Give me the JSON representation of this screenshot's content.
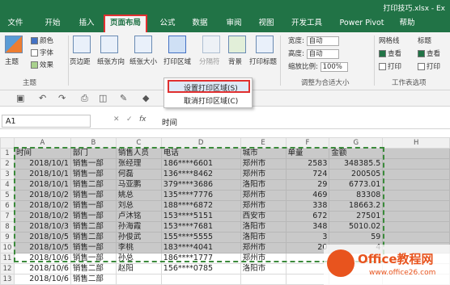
{
  "window": {
    "title": "打印技巧.xlsx - Ex"
  },
  "tabs": [
    "文件",
    "开始",
    "插入",
    "页面布局",
    "公式",
    "数据",
    "审阅",
    "视图",
    "开发工具",
    "Power Pivot",
    "帮助"
  ],
  "ribbon": {
    "theme": {
      "main": "主题",
      "colors": "颜色",
      "fonts": "字体",
      "effects": "效果"
    },
    "page_setup": {
      "margins": "页边距",
      "orientation": "纸张方向",
      "size": "纸张大小",
      "print_area": "打印区域",
      "breaks": "分隔符",
      "background": "背景",
      "print_titles": "打印标题"
    },
    "scale": {
      "width_label": "宽度:",
      "width_value": "自动",
      "height_label": "高度:",
      "height_value": "自动",
      "scale_label": "缩放比例:",
      "scale_value": "100%",
      "group": "调整为合适大小"
    },
    "sheet_options": {
      "gridlines": "网格线",
      "headings": "标题",
      "view1": "查看",
      "view2": "查看",
      "print1": "打印",
      "print2": "打印",
      "group": "工作表选项"
    },
    "group_theme": "主题"
  },
  "menu": {
    "set": "设置打印区域(S)",
    "clear": "取消打印区域(C)"
  },
  "namebox": "A1",
  "formula": "时间",
  "columns": [
    "A",
    "B",
    "C",
    "D",
    "E",
    "F",
    "G",
    "H"
  ],
  "rows": [
    [
      "时间",
      "部门",
      "销售人员",
      "电话",
      "城市",
      "单量",
      "金额"
    ],
    [
      "2018/10/1",
      "销售一部",
      "张经理",
      "186****6601",
      "郑州市",
      "2583",
      "348385.5"
    ],
    [
      "2018/10/1",
      "销售一部",
      "何磊",
      "136****8462",
      "郑州市",
      "724",
      "200505"
    ],
    [
      "2018/10/1",
      "销售二部",
      "马亚鹏",
      "379****3686",
      "洛阳市",
      "29",
      "6773.01"
    ],
    [
      "2018/10/2",
      "销售一部",
      "姚总",
      "135****7776",
      "郑州市",
      "469",
      "83308"
    ],
    [
      "2018/10/2",
      "销售一部",
      "刘总",
      "188****6872",
      "郑州市",
      "338",
      "18663.2"
    ],
    [
      "2018/10/2",
      "销售一部",
      "卢沐铭",
      "153****5151",
      "西安市",
      "672",
      "27501"
    ],
    [
      "2018/10/3",
      "销售二部",
      "孙海霞",
      "153****7681",
      "洛阳市",
      "348",
      "5010.02"
    ],
    [
      "2018/10/5",
      "销售二部",
      "孙俊武",
      "155****5555",
      "洛阳市",
      "3",
      "59"
    ],
    [
      "2018/10/5",
      "销售一部",
      "李桃",
      "183****4041",
      "郑州市",
      "20",
      "4"
    ],
    [
      "2018/10/6",
      "销售一部",
      "孙总",
      "186****1777",
      "郑州市",
      "",
      ""
    ],
    [
      "2018/10/6",
      "销售二部",
      "赵阳",
      "156****0785",
      "洛阳市",
      "",
      ""
    ],
    [
      "2018/10/6",
      "销售二部",
      "",
      "",
      "",
      "",
      ""
    ]
  ],
  "row_numbers": [
    "1",
    "2",
    "3",
    "4",
    "5",
    "6",
    "7",
    "8",
    "9",
    "10",
    "11",
    "12",
    "13"
  ],
  "watermark": {
    "title": "Office教程网",
    "subtitle": "www.office26.com"
  }
}
